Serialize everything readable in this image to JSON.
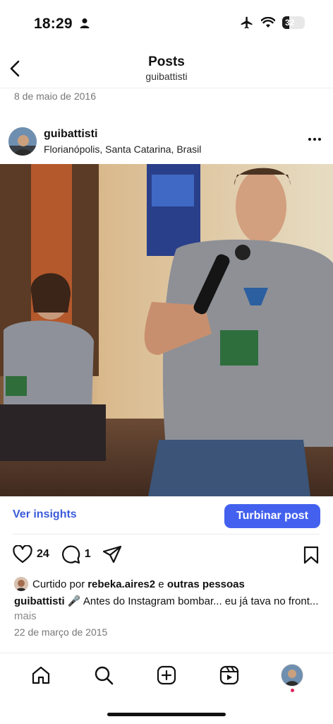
{
  "status": {
    "time": "18:29",
    "battery": "32",
    "battery_level": 0.32
  },
  "header": {
    "title": "Posts",
    "subtitle": "guibattisti"
  },
  "previous_post_date": "8 de maio de 2016",
  "post": {
    "username": "guibattisti",
    "location": "Florianópolis, Santa Catarina, Brasil",
    "insights_label": "Ver insights",
    "boost_label": "Turbinar post",
    "likes": "24",
    "comments": "1",
    "liked_prefix": "Curtido por ",
    "liked_user": "rebeka.aires2",
    "liked_mid": " e ",
    "liked_suffix": "outras pessoas",
    "caption_user": "guibattisti",
    "caption_text": " 🎤 Antes do Instagram bombar... eu já tava no front...",
    "caption_more": "mais",
    "date": "22 de março de 2015"
  },
  "colors": {
    "accent": "#4361ee",
    "notification": "#e0245e"
  },
  "icons": [
    "back-icon",
    "more-icon",
    "heart-icon",
    "comment-icon",
    "share-icon",
    "bookmark-icon",
    "home-icon",
    "search-icon",
    "create-icon",
    "reels-icon"
  ]
}
